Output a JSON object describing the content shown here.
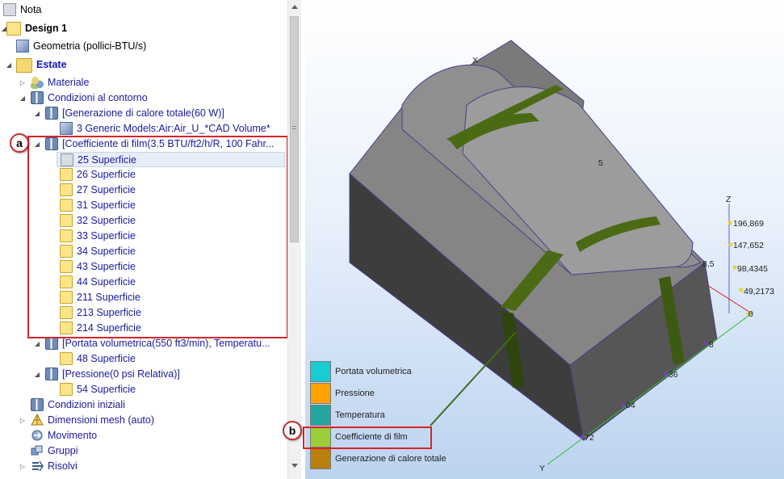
{
  "tree": {
    "nota": "Nota",
    "design": "Design 1",
    "geometria": "Geometria (pollici-BTU/s)",
    "estate": "Estate",
    "materiale": "Materiale",
    "condizioni_contorno": "Condizioni al contorno",
    "generazione": "[Generazione di calore totale(60 W)]",
    "generic_models": "3 Generic Models:Air:Air_U_*CAD Volume*",
    "coefficiente": "[Coefficiente di film(3.5 BTU/ft2/h/R, 100 Fahr...",
    "superfici": [
      "25 Superficie",
      "26 Superficie",
      "27 Superficie",
      "31 Superficie",
      "32 Superficie",
      "33 Superficie",
      "34 Superficie",
      "43 Superficie",
      "44 Superficie",
      "211 Superficie",
      "213 Superficie",
      "214 Superficie"
    ],
    "portata": "[Portata volumetrica(550 ft3/min), Temperatu...",
    "sup48": "48 Superficie",
    "pressione": "[Pressione(0 psi Relativa)]",
    "sup54": "54 Superficie",
    "condizioni_iniziali": "Condizioni iniziali",
    "dimensioni_mesh": "Dimensioni mesh (auto)",
    "movimento": "Movimento",
    "gruppi": "Gruppi",
    "risolvi": "Risolvi"
  },
  "callouts": {
    "a": "a",
    "b": "b"
  },
  "legend": [
    {
      "label": "Portata volumetrica",
      "color": "#19ccd4"
    },
    {
      "label": "Pressione",
      "color": "#ffa200"
    },
    {
      "label": "Temperatura",
      "color": "#23a7a0"
    },
    {
      "label": "Coefficiente di film",
      "color": "#9ccd3a"
    },
    {
      "label": "Generazione di calore totale",
      "color": "#b9800e"
    }
  ],
  "axes": {
    "x": "X",
    "y": "Y",
    "z": "Z",
    "z_ticks": [
      "196,869",
      "147,652",
      "98,4345",
      "49,2173",
      "0"
    ],
    "y_ticks": [
      "8",
      "36",
      "04",
      "72"
    ],
    "misc_ticks": [
      "5",
      "8,5"
    ]
  }
}
